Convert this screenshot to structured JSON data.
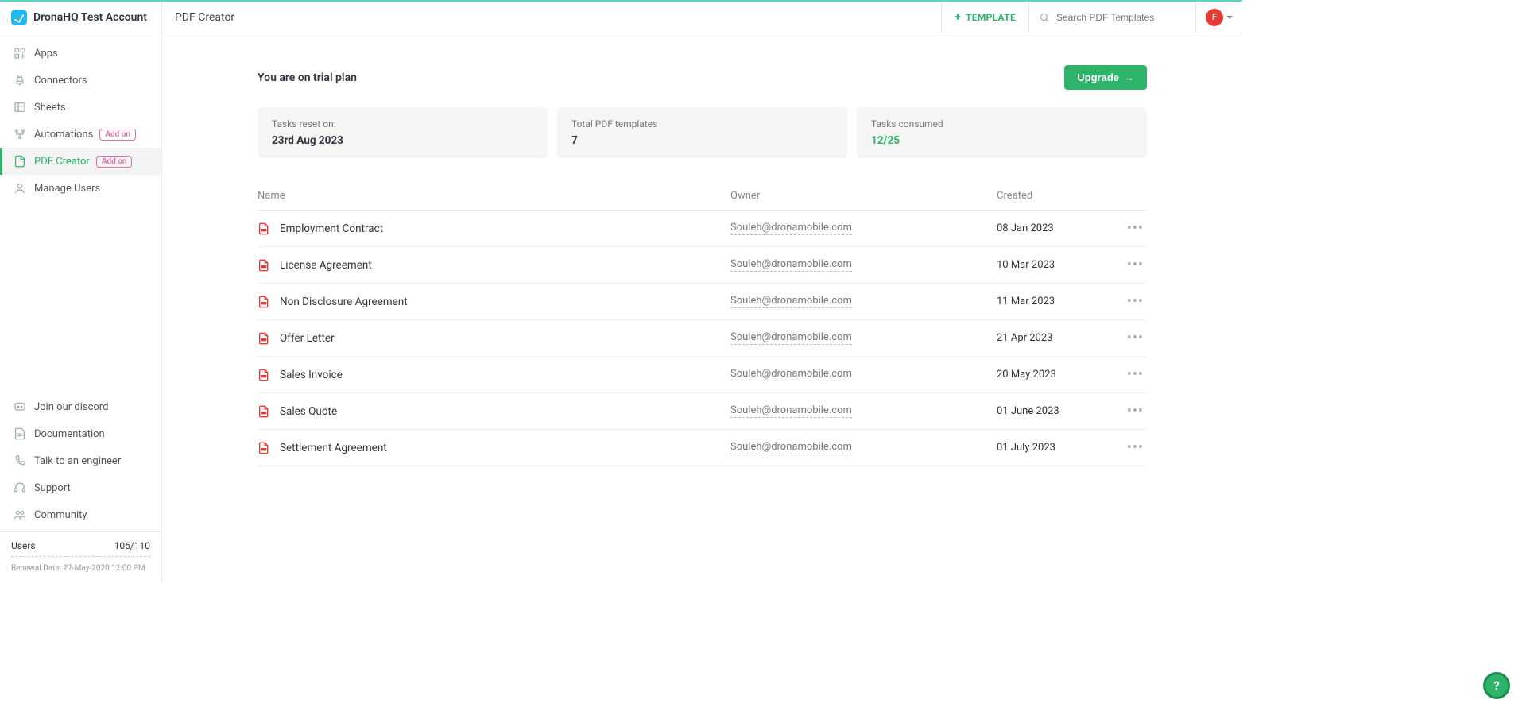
{
  "brand": {
    "name": "DronaHQ Test Account"
  },
  "header": {
    "page_title": "PDF Creator",
    "template_btn": "TEMPLATE",
    "search_placeholder": "Search PDF Templates",
    "avatar_initial": "F"
  },
  "sidebar": {
    "nav": [
      {
        "label": "Apps",
        "icon": "apps-icon",
        "addon": false,
        "active": false
      },
      {
        "label": "Connectors",
        "icon": "plug-icon",
        "addon": false,
        "active": false
      },
      {
        "label": "Sheets",
        "icon": "table-icon",
        "addon": false,
        "active": false
      },
      {
        "label": "Automations",
        "icon": "bolt-icon",
        "addon": true,
        "active": false
      },
      {
        "label": "PDF Creator",
        "icon": "pdf-icon",
        "addon": true,
        "active": true
      },
      {
        "label": "Manage Users",
        "icon": "user-icon",
        "addon": false,
        "active": false
      }
    ],
    "addon_pill": "Add on",
    "bottom": [
      {
        "label": "Join our discord",
        "icon": "discord-icon"
      },
      {
        "label": "Documentation",
        "icon": "doc-icon"
      },
      {
        "label": "Talk to an engineer",
        "icon": "phone-icon"
      },
      {
        "label": "Support",
        "icon": "headset-icon"
      },
      {
        "label": "Community",
        "icon": "community-icon"
      }
    ],
    "footer": {
      "users_label": "Users",
      "users_value": "106/110",
      "renewal": "Renewal Date: 27-May-2020 12:00 PM"
    }
  },
  "main": {
    "notice": "You are on trial plan",
    "upgrade_label": "Upgrade",
    "stats": [
      {
        "label": "Tasks reset on:",
        "value": "23rd Aug 2023",
        "green": false
      },
      {
        "label": "Total PDF templates",
        "value": "7",
        "green": false
      },
      {
        "label": "Tasks consumed",
        "value": "12/25",
        "green": true
      }
    ],
    "columns": {
      "name": "Name",
      "owner": "Owner",
      "created": "Created"
    },
    "rows": [
      {
        "name": "Employment Contract",
        "owner": "Souleh@dronamobile.com",
        "created": "08 Jan 2023"
      },
      {
        "name": "License Agreement",
        "owner": "Souleh@dronamobile.com",
        "created": "10 Mar 2023"
      },
      {
        "name": "Non Disclosure Agreement",
        "owner": "Souleh@dronamobile.com",
        "created": "11 Mar 2023"
      },
      {
        "name": "Offer Letter",
        "owner": "Souleh@dronamobile.com",
        "created": "21 Apr 2023"
      },
      {
        "name": "Sales Invoice",
        "owner": "Souleh@dronamobile.com",
        "created": "20 May 2023"
      },
      {
        "name": "Sales Quote",
        "owner": "Souleh@dronamobile.com",
        "created": "01 June 2023"
      },
      {
        "name": "Settlement Agreement",
        "owner": "Souleh@dronamobile.com",
        "created": "01 July 2023"
      }
    ]
  },
  "help_fab": "?"
}
